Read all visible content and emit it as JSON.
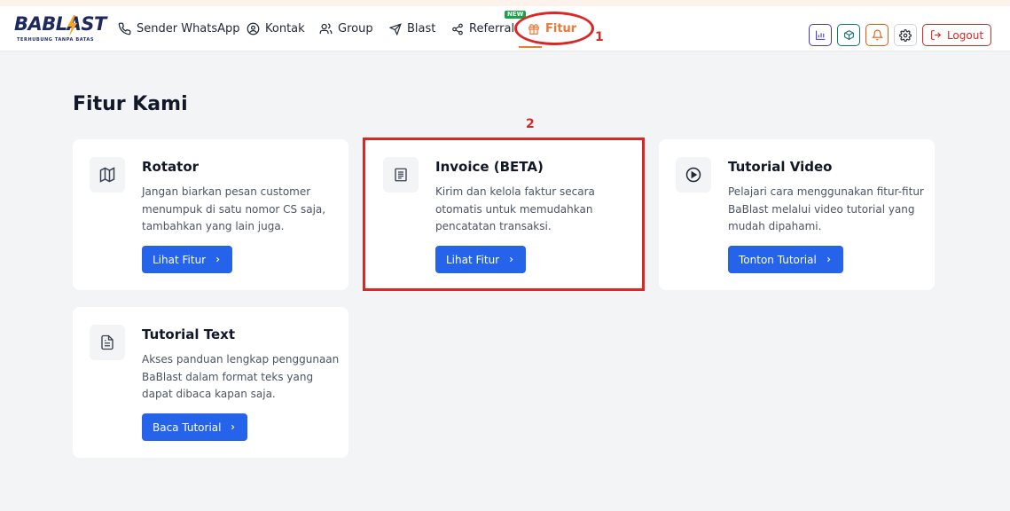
{
  "app": {
    "brand": "BABLAST",
    "tagline": "TERHUBUNG TANPA BATAS"
  },
  "nav": {
    "items": [
      {
        "label": "Sender WhatsApp",
        "icon": "phone-icon"
      },
      {
        "label": "Kontak",
        "icon": "user-circle-icon"
      },
      {
        "label": "Group",
        "icon": "users-icon"
      },
      {
        "label": "Blast",
        "icon": "send-icon"
      },
      {
        "label": "Referral",
        "icon": "share-icon"
      },
      {
        "label": "Fitur",
        "icon": "gift-icon",
        "active": true
      }
    ],
    "new_badge": "NEW",
    "logout_label": "Logout"
  },
  "annotations": {
    "marker_1": "1",
    "marker_2": "2"
  },
  "main": {
    "title": "Fitur Kami",
    "cards": [
      {
        "title": "Rotator",
        "description": "Jangan biarkan pesan customer menumpuk di satu nomor CS saja, tambahkan yang lain juga.",
        "button": "Lihat Fitur",
        "icon": "map-icon"
      },
      {
        "title": "Invoice (BETA)",
        "description": "Kirim dan kelola faktur secara otomatis untuk memudahkan pencatatan transaksi.",
        "button": "Lihat Fitur",
        "icon": "receipt-icon"
      },
      {
        "title": "Tutorial Video",
        "description": "Pelajari cara menggunakan fitur-fitur BaBlast melalui video tutorial yang mudah dipahami.",
        "button": "Tonton Tutorial",
        "icon": "play-circle-icon"
      },
      {
        "title": "Tutorial Text",
        "description": "Akses panduan lengkap penggunaan BaBlast dalam format teks yang dapat dibaca kapan saja.",
        "button": "Baca Tutorial",
        "icon": "document-icon"
      }
    ]
  },
  "colors": {
    "accent": "#ea7a35",
    "primary_button": "#2563eb",
    "annotation": "#dc2626"
  }
}
